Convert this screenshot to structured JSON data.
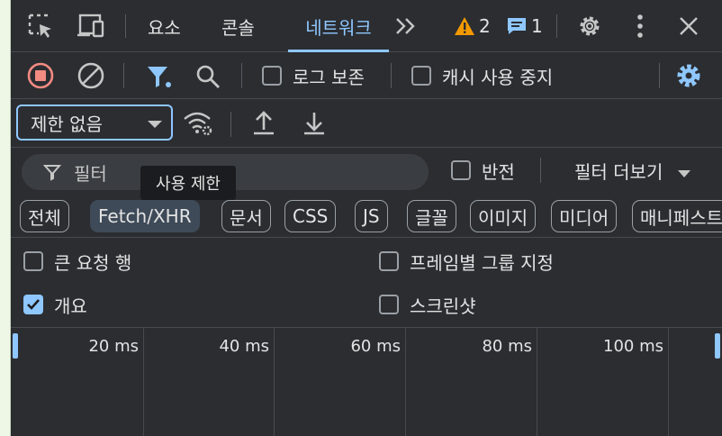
{
  "tabs": {
    "elements": "요소",
    "console": "콘솔",
    "network": "네트워크",
    "more": "»"
  },
  "badges": {
    "warnings": "2",
    "messages": "1"
  },
  "toolbar1": {
    "preserve_log": "로그 보존",
    "disable_cache": "캐시 사용 중지"
  },
  "toolbar2": {
    "throttle_value": "제한 없음"
  },
  "filter": {
    "placeholder": "필터",
    "invert": "반전",
    "more_filters": "필터 더보기",
    "tooltip": "사용 제한"
  },
  "chips": [
    "전체",
    "Fetch/XHR",
    "문서",
    "CSS",
    "JS",
    "글꼴",
    "이미지",
    "미디어",
    "매니페스트"
  ],
  "options": {
    "big_request_rows": "큰 요청 행",
    "group_by_frame": "프레임별 그룹 지정",
    "overview": "개요",
    "screenshots": "스크린샷"
  },
  "timeline": {
    "ticks": [
      "20 ms",
      "40 ms",
      "60 ms",
      "80 ms",
      "100 ms"
    ]
  },
  "colors": {
    "accent": "#8fc7ff",
    "record_red": "#f28b82",
    "warning_orange": "#f29900",
    "filter_blue": "#8fc7ff"
  }
}
